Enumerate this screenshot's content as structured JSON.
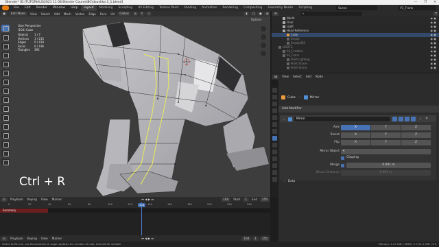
{
  "title": "Blender* [D:\\TUTORIALS\\2021 11 08 Blender Course\\BC\\doushka 3_1.blend]",
  "window_buttons": [
    "—",
    "❐",
    "✕"
  ],
  "menu": [
    "File",
    "Edit",
    "Render",
    "Window",
    "Help"
  ],
  "workspaces": [
    "Layout",
    "Modeling",
    "Sculpting",
    "UV Editing",
    "Texture Paint",
    "Shading",
    "Animation",
    "Rendering",
    "Compositing",
    "Geometry Nodes",
    "Scripting"
  ],
  "active_workspace": "Layout",
  "scene": "Scene",
  "view_layer": "V1_Frank",
  "viewport": {
    "mode": "Edit Mode",
    "header_menus": [
      "View",
      "Select",
      "Add",
      "Mesh",
      "Vertex",
      "Edge",
      "Face",
      "UV"
    ],
    "transform": "Global",
    "options": "Options",
    "view_name": "User Perspective",
    "object_name": "(104) Cube",
    "stats": [
      {
        "k": "Objects",
        "v": "1 / 7"
      },
      {
        "k": "Vertices",
        "v": "1 / 215"
      },
      {
        "k": "Edges",
        "v": "0 / 410"
      },
      {
        "k": "Faces",
        "v": "0 / 196"
      },
      {
        "k": "Triangles",
        "v": "392"
      }
    ],
    "shortcut_overlay": "Ctrl + R"
  },
  "timeline": {
    "menus": [
      "Playback",
      "Keying",
      "View",
      "Marker"
    ],
    "current_frame": "104",
    "start_label": "Start",
    "start": "1",
    "end_label": "End",
    "end": "250",
    "ticks": [
      "0",
      "20",
      "40",
      "60",
      "80",
      "100",
      "120",
      "140",
      "160",
      "180",
      "200",
      "220",
      "240"
    ],
    "summary": "Summary"
  },
  "timeline_footer": {
    "menus": [
      "Playback",
      "Keying",
      "View",
      "Marker"
    ],
    "current_frame": "104",
    "start": "1",
    "end": "250"
  },
  "status_left": "Select to Re-Cut, use Mousewheel or page up/down for number of cuts, hold Alt for smooth",
  "status_right": "Memory: 1.47 GiB | VRAM: 2.7/11.0 GiB | 3.0",
  "outliner": {
    "rows": [
      {
        "label": "World",
        "indent": 2,
        "dim": false,
        "sel": false
      },
      {
        "label": "Floor",
        "indent": 2,
        "dim": false,
        "sel": false
      },
      {
        "label": "Light",
        "indent": 2,
        "dim": false,
        "sel": false
      },
      {
        "label": "Hand Reference",
        "indent": 2,
        "dim": false,
        "sel": false
      },
      {
        "label": "Cube",
        "indent": 3,
        "dim": false,
        "sel": true
      },
      {
        "label": "Empty",
        "indent": 3,
        "dim": true,
        "sel": false
      },
      {
        "label": "Empty.001",
        "indent": 3,
        "dim": true,
        "sel": false
      },
      {
        "label": "LIGHTS",
        "indent": 1,
        "dim": true,
        "sel": false
      },
      {
        "label": "03_Creation",
        "indent": 2,
        "dim": true,
        "sel": false
      },
      {
        "label": "03_Frank",
        "indent": 2,
        "dim": true,
        "sel": false
      },
      {
        "label": "Point Lighting",
        "indent": 3,
        "dim": true,
        "sel": false
      },
      {
        "label": "Point Scene",
        "indent": 3,
        "dim": true,
        "sel": false
      },
      {
        "label": "Point Scene",
        "indent": 3,
        "dim": true,
        "sel": false
      }
    ]
  },
  "properties": {
    "header_menus": [
      "View",
      "Select",
      "Add",
      "Node"
    ],
    "breadcrumb": {
      "object": "Cube",
      "modifier": "Mirror"
    },
    "add_modifier": "Add Modifier",
    "modifier": {
      "name": "Mirror",
      "axis_label": "Axis",
      "bisect_label": "Bisect",
      "flip_label": "Flip",
      "axes": [
        "X",
        "Y",
        "Z"
      ],
      "axis_active": "X",
      "mirror_object_label": "Mirror Object",
      "clipping_label": "Clipping",
      "merge_label": "Merge",
      "merge_value": "0.001 m",
      "bisect_distance_label": "Bisect Distance",
      "bisect_distance_value": "0.001 m",
      "data_label": "Data"
    }
  },
  "colors": {
    "accent": "#4772b3",
    "selection_wire": "#ffa000",
    "seam": "#e8e860"
  }
}
